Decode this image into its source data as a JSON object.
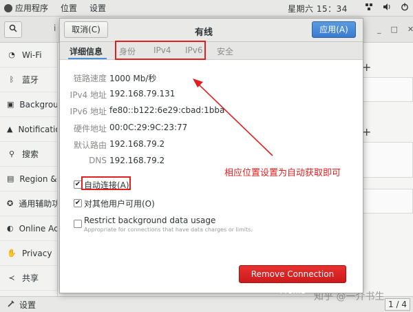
{
  "topbar": {
    "menu": [
      "应用程序",
      "位置",
      "设置"
    ],
    "clock": "星期六 15：34",
    "tray_icons": [
      "network-icon",
      "volume-icon",
      "power-icon"
    ]
  },
  "settings_window": {
    "title_fragment": "i",
    "sidebar": [
      {
        "icon": "wifi-icon",
        "label": "Wi-Fi"
      },
      {
        "icon": "bluetooth-icon",
        "label": "蓝牙"
      },
      {
        "icon": "background-icon",
        "label": "Background"
      },
      {
        "icon": "notification-icon",
        "label": "Notification"
      },
      {
        "icon": "search-icon",
        "label": "搜索"
      },
      {
        "icon": "region-icon",
        "label": "Region & L"
      },
      {
        "icon": "accessibility-icon",
        "label": "通用辅助功"
      },
      {
        "icon": "online-accounts-icon",
        "label": "Online Acc"
      },
      {
        "icon": "privacy-icon",
        "label": "Privacy"
      },
      {
        "icon": "share-icon",
        "label": "共享"
      }
    ]
  },
  "dialog": {
    "title": "有线",
    "cancel_label": "取消(C)",
    "apply_label": "应用(A)",
    "tabs": [
      "详细信息",
      "身份",
      "IPv4",
      "IPv6",
      "安全"
    ],
    "active_tab": "详细信息",
    "details": [
      {
        "label": "链路速度",
        "value": "1000 Mb/秒"
      },
      {
        "label": "IPv4 地址",
        "value": "192.168.79.131"
      },
      {
        "label": "IPv6 地址",
        "value": "fe80::b122:6e29:cbad:1bba"
      },
      {
        "label": "硬件地址",
        "value": "00:0C:29:9C:23:77"
      },
      {
        "label": "默认路由",
        "value": "192.168.79.2"
      },
      {
        "label": "DNS",
        "value": "192.168.79.2"
      }
    ],
    "auto_connect": {
      "label": "自动连接(A)",
      "checked": true
    },
    "all_users": {
      "label": "对其他用户可用(O)",
      "checked": true
    },
    "restrict_data": {
      "label": "Restrict background data usage",
      "sublabel": "Appropriate for connections that have data charges or limits.",
      "checked": false
    },
    "remove_label": "Remove Connection Profile"
  },
  "annotation": {
    "text": "相应位置设置为自动获取即可",
    "color": "#e02020"
  },
  "taskbar": {
    "task_label": "设置",
    "pager": "1 / 4"
  },
  "watermark": "知乎 @一介书生",
  "colors": {
    "apply": "#3a7bd0",
    "remove": "#cc1a1a",
    "highlight": "#e02020"
  }
}
